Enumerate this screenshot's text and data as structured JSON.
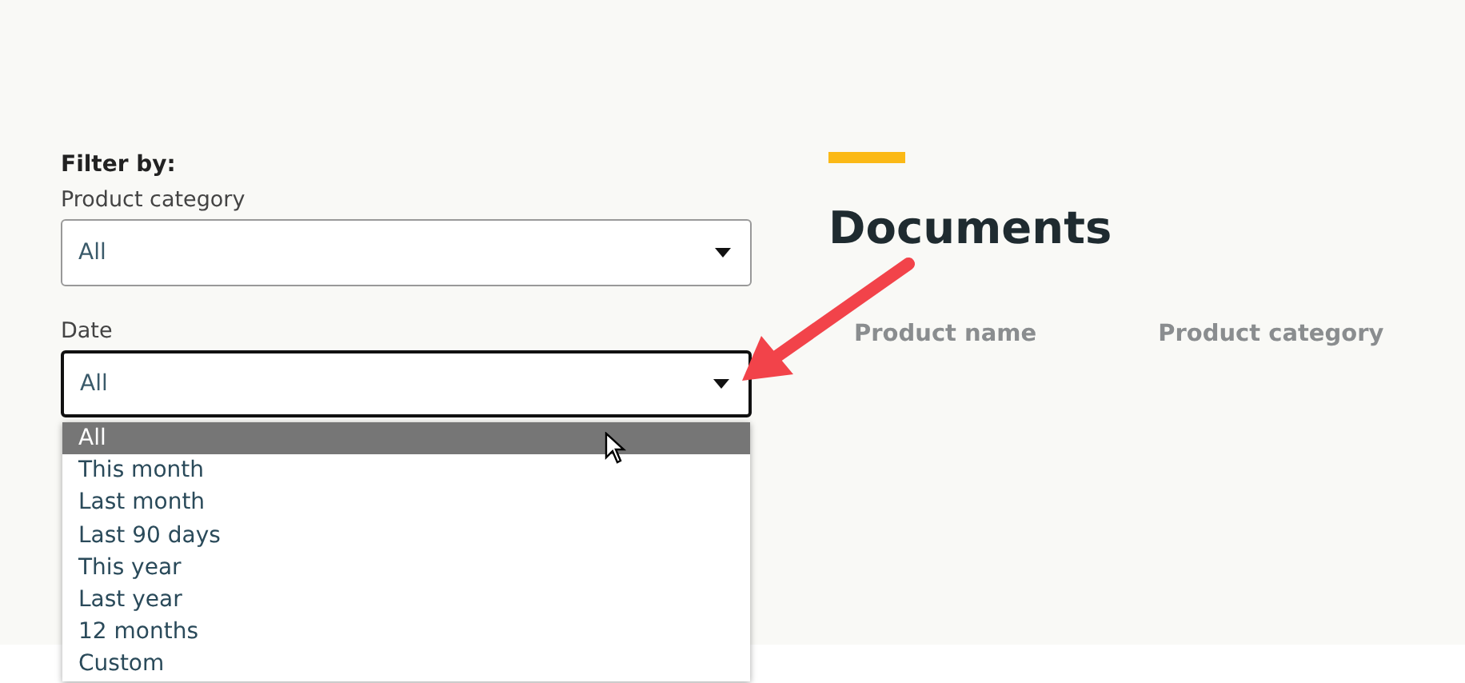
{
  "filter": {
    "heading": "Filter by:",
    "fields": [
      {
        "label": "Product category",
        "value": "All",
        "focused": false
      },
      {
        "label": "Date",
        "value": "All",
        "focused": true,
        "options": [
          {
            "label": "All",
            "selected": true
          },
          {
            "label": "This month",
            "selected": false
          },
          {
            "label": "Last month",
            "selected": false
          },
          {
            "label": "Last 90 days",
            "selected": false
          },
          {
            "label": "This year",
            "selected": false
          },
          {
            "label": "Last year",
            "selected": false
          },
          {
            "label": "12 months",
            "selected": false
          },
          {
            "label": "Custom",
            "selected": false
          }
        ]
      }
    ]
  },
  "documents": {
    "title": "Documents",
    "columns": [
      "Product name",
      "Product category"
    ]
  }
}
